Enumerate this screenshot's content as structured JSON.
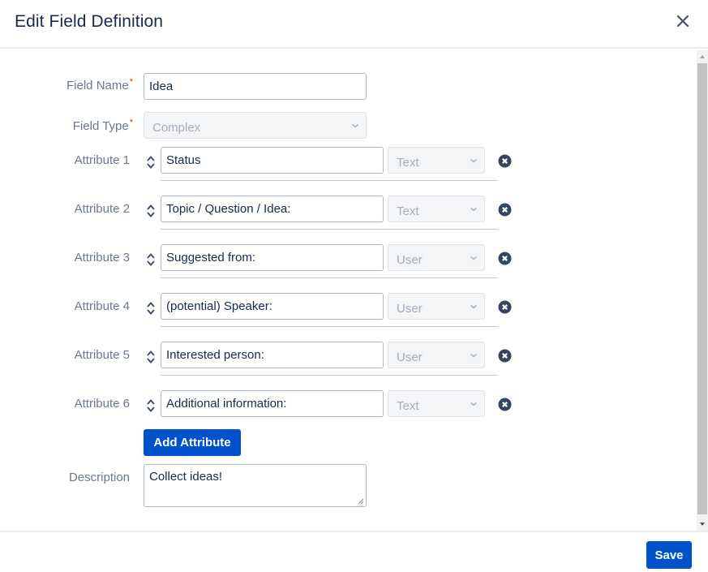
{
  "header": {
    "title": "Edit Field Definition",
    "close_icon": "close-icon"
  },
  "form": {
    "field_name": {
      "label": "Field Name",
      "required_mark": "*",
      "value": "Idea"
    },
    "field_type": {
      "label": "Field Type",
      "required_mark": "*",
      "value": "Complex",
      "disabled": true
    },
    "attributes": [
      {
        "label": "Attribute 1",
        "name": "Status",
        "type": "Text"
      },
      {
        "label": "Attribute 2",
        "name": "Topic / Question / Idea:",
        "type": "Text"
      },
      {
        "label": "Attribute 3",
        "name": "Suggested from:",
        "type": "User"
      },
      {
        "label": "Attribute 4",
        "name": "(potential) Speaker:",
        "type": "User"
      },
      {
        "label": "Attribute 5",
        "name": "Interested person:",
        "type": "User"
      },
      {
        "label": "Attribute 6",
        "name": "Additional information:",
        "type": "Text"
      }
    ],
    "add_attribute_label": "Add Attribute",
    "description": {
      "label": "Description",
      "value": "Collect ideas!"
    }
  },
  "footer": {
    "save_label": "Save"
  },
  "colors": {
    "primary": "#0052cc",
    "title_text": "#172b4d",
    "label_text": "#6b778c",
    "required": "#de350b",
    "remove_icon": "#344563"
  }
}
